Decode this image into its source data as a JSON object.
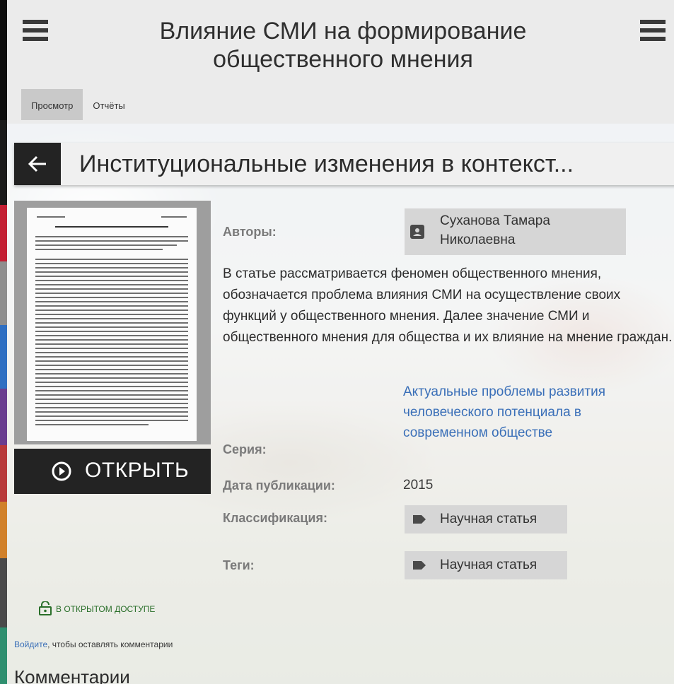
{
  "left_strip_colors": [
    "#0d0d0d",
    "#c31f33",
    "#8e8e8e",
    "#e3b327",
    "#2e6fc2",
    "#6a3d8f",
    "#b83a3a",
    "#2f8f6f",
    "#d1812a",
    "#4a4a4a"
  ],
  "header": {
    "title": "Влияние СМИ на формирование общественного мнения",
    "tabs": [
      {
        "label": "Просмотр",
        "active": true
      },
      {
        "label": "Отчёты",
        "active": false
      }
    ]
  },
  "record": {
    "title": "Институциональные изменения в контекст...",
    "open_button": "ОТКРЫТЬ",
    "authors_label": "Авторы:",
    "author": "Суханова Тамара Николаевна",
    "abstract": "В статье рассматривается феномен общественного мнения, обозначается проблема влияния СМИ на осуществление своих функций у общественного мнения. Далее значение СМИ и общественного мнения для общества и их влияние на мнение граждан.",
    "series_label": "Серия:",
    "series_value": "Актуальные проблемы развития человеческого потенциала в современном обществе",
    "date_label": "Дата публикации:",
    "date_value": "2015",
    "classification_label": "Классификация:",
    "classification_value": "Научная статья",
    "tags_label": "Теги:",
    "tags_value": "Научная статья",
    "access": "В ОТКРЫТОМ ДОСТУПЕ"
  },
  "comments": {
    "login_link": "Войдите",
    "login_hint": ", чтобы оставлять комментарии",
    "title": "Комментарии"
  },
  "colors": {
    "dark_button": "#232323",
    "link": "#3a6fb8",
    "access_green": "#2a6f2a",
    "chip": "#d6d6d6"
  },
  "icons": {
    "menu": "hamburger-menu-icon",
    "back": "arrow-left-icon",
    "open": "play-circle-icon",
    "author": "person-icon",
    "tag": "label-tag-icon",
    "access": "unlock-icon"
  }
}
